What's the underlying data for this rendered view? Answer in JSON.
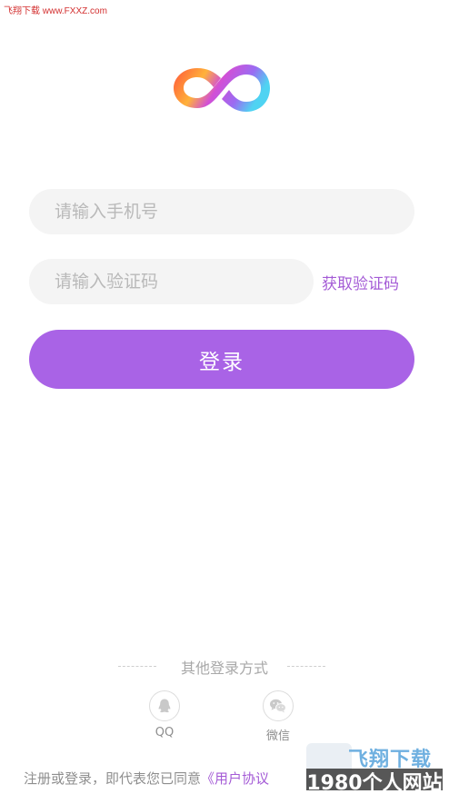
{
  "watermark_top": "飞翔下载 www.FXXZ.com",
  "logo": {
    "icon": "infinity-logo",
    "colors": [
      "#ff5a3c",
      "#ffb03a",
      "#c04bdc",
      "#8a6cf0",
      "#4fd0f0"
    ]
  },
  "form": {
    "phone_placeholder": "请输入手机号",
    "code_placeholder": "请输入验证码",
    "get_code_label": "获取验证码",
    "login_label": "登录"
  },
  "other_login": {
    "title": "其他登录方式",
    "options": [
      {
        "label": "QQ",
        "icon": "qq-icon"
      },
      {
        "label": "微信",
        "icon": "wechat-icon"
      }
    ]
  },
  "agreement": {
    "prefix": "注册或登录，即代表您已同意",
    "link": "《用户协议"
  },
  "watermark_bottom": {
    "top_text": "飞翔下载",
    "bottom_text": "1980个人网站"
  },
  "colors": {
    "accent": "#a963e6",
    "link": "#a45bd6",
    "field_bg": "#f4f4f4"
  }
}
